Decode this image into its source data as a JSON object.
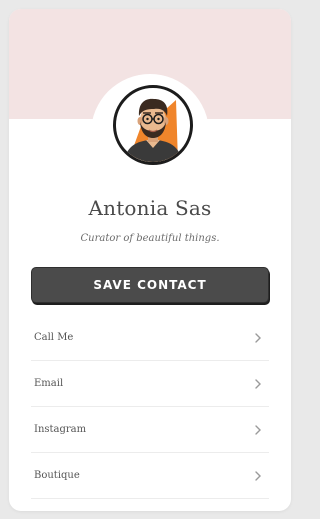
{
  "profile": {
    "name": "Antonia Sas",
    "tagline": "Curator of  beautiful things."
  },
  "actions": {
    "save_label": "SAVE CONTACT"
  },
  "links": [
    {
      "label": "Call Me",
      "icon": "chevron-right-icon"
    },
    {
      "label": "Email",
      "icon": "chevron-right-icon"
    },
    {
      "label": "Instagram",
      "icon": "chevron-right-icon"
    },
    {
      "label": "Boutique",
      "icon": "chevron-right-icon"
    }
  ],
  "colors": {
    "cover": "#f3e3e3",
    "button": "#4b4b4b",
    "avatar_accent": "#f0852b"
  }
}
